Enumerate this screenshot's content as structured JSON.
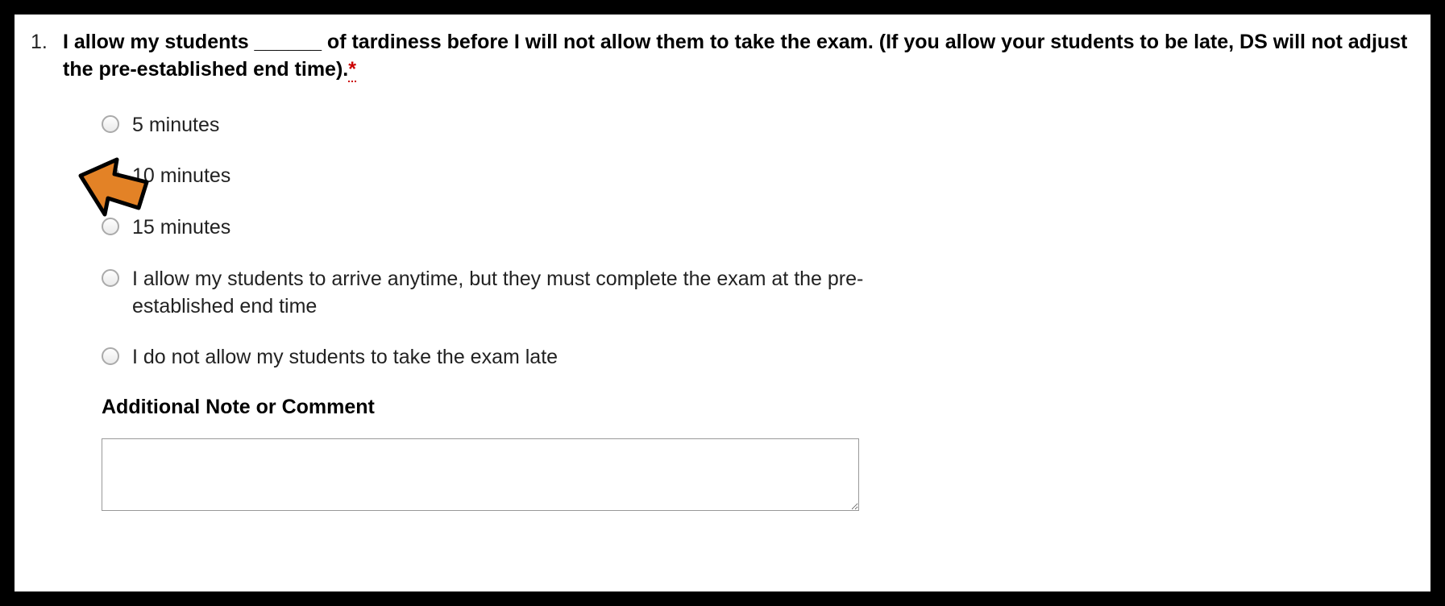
{
  "question": {
    "number": "1.",
    "text": "I allow my students ______ of tardiness before I will not allow them to take the exam. (If you allow your students to be late, DS will not adjust the pre-established end time).",
    "required_marker": "*"
  },
  "options": [
    {
      "label": "5 minutes",
      "selected": false
    },
    {
      "label": "10 minutes",
      "selected": true
    },
    {
      "label": "15 minutes",
      "selected": false
    },
    {
      "label": "I allow my students to arrive anytime, but they must complete the exam at the pre-established end time",
      "selected": false
    },
    {
      "label": "I do not allow my students to take the exam late",
      "selected": false
    }
  ],
  "note_label": "Additional Note or Comment",
  "note_value": "",
  "annotation": {
    "arrow_color": "#e38226",
    "arrow_stroke": "#000000"
  }
}
